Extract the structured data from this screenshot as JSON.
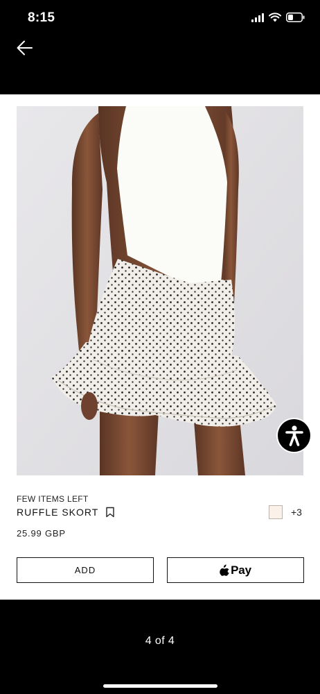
{
  "status_bar": {
    "time": "8:15",
    "icons": [
      "signal-icon",
      "wifi-icon",
      "battery-icon"
    ]
  },
  "nav": {
    "back_icon": "arrow-left-icon"
  },
  "product": {
    "stock_label": "FEW ITEMS LEFT",
    "name": "RUFFLE SKORT",
    "price": "25.99 GBP",
    "bookmark_icon": "bookmark-icon",
    "color_swatch": "#fbf1e8",
    "more_colors": "+3"
  },
  "actions": {
    "add_label": "ADD",
    "apple_pay_label": "Pay",
    "apple_icon": "apple-icon"
  },
  "accessibility_icon": "accessibility-icon",
  "footer": {
    "page_indicator": "4 of 4"
  },
  "colors": {
    "background": "#000000",
    "card": "#ffffff",
    "text": "#111111"
  }
}
